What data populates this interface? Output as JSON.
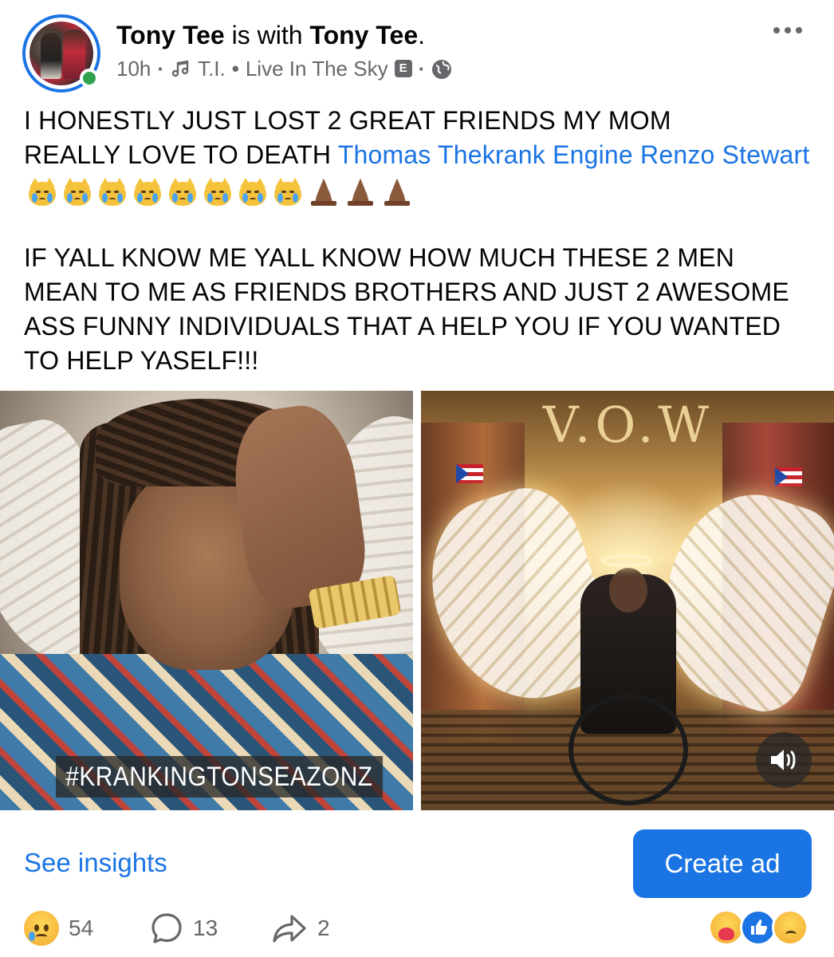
{
  "header": {
    "author_name": "Tony Tee",
    "with_text": "is with",
    "tagged_name": "Tony Tee",
    "tagged_suffix": ".",
    "time_ago": "10h",
    "dot": "·",
    "song_artist": "T.I.",
    "song_separator": "•",
    "song_title": "Live In The Sky",
    "explicit_badge": "E",
    "audience_icon": "globe-icon",
    "more_icon": "more-dots-icon"
  },
  "post": {
    "line1": "I HONESTLY JUST LOST 2 GREAT FRIENDS MY MOM",
    "line2_prefix": "REALLY LOVE TO DEATH ",
    "tag1": "Thomas Thekrank Engine",
    "tag2": "Renzo Stewart",
    "emoji_crying_cat_count": 8,
    "emoji_praying_count": 3,
    "paragraph2": "IF YALL KNOW ME YALL KNOW HOW MUCH THESE 2 MEN MEAN TO ME AS FRIENDS BROTHERS AND JUST 2 AWESOME ASS FUNNY INDIVIDUALS THAT A HELP YOU IF YOU WANTED TO HELP YASELF!!!"
  },
  "media": {
    "left_hashtag": "#KRANKINGTONSEAZONZ",
    "right_sign": "V.O.W",
    "sound_icon": "speaker-icon"
  },
  "footer": {
    "see_insights": "See insights",
    "create_ad": "Create ad",
    "reactions_count": "54",
    "comments_count": "13",
    "shares_count": "2"
  },
  "colors": {
    "accent": "#1b74e4",
    "secondary_text": "#65676b",
    "online": "#31a24c"
  }
}
